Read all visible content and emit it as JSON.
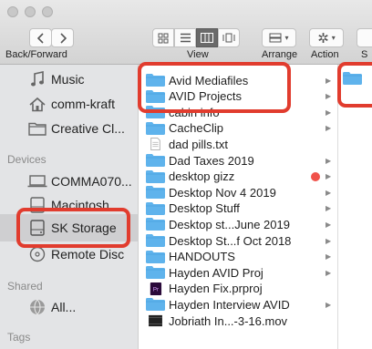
{
  "toolbar": {
    "nav_label": "Back/Forward",
    "view_label": "View",
    "arrange_label": "Arrange",
    "action_label": "Action",
    "clipped_label": "S"
  },
  "sidebar": {
    "favorites": [
      {
        "label": "Music",
        "icon": "music-note-icon"
      },
      {
        "label": "comm-kraft",
        "icon": "home-icon"
      },
      {
        "label": "Creative Cl...",
        "icon": "folder-icon"
      }
    ],
    "devices_header": "Devices",
    "devices": [
      {
        "label": "COMMA070...",
        "icon": "laptop-icon"
      },
      {
        "label": "Macintosh...",
        "icon": "disk-icon"
      },
      {
        "label": "SK Storage",
        "icon": "disk-icon"
      },
      {
        "label": "Remote Disc",
        "icon": "disc-icon"
      }
    ],
    "shared_header": "Shared",
    "shared": [
      {
        "label": "All...",
        "icon": "network-icon"
      }
    ],
    "tags_header": "Tags"
  },
  "files": [
    {
      "name": "Avid Mediafiles",
      "type": "folder",
      "chevron": true
    },
    {
      "name": "AVID Projects",
      "type": "folder",
      "chevron": true
    },
    {
      "name": "cabin info",
      "type": "folder",
      "chevron": true
    },
    {
      "name": "CacheClip",
      "type": "folder",
      "chevron": true
    },
    {
      "name": "dad pills.txt",
      "type": "text",
      "chevron": false
    },
    {
      "name": "Dad Taxes 2019",
      "type": "folder",
      "chevron": true
    },
    {
      "name": "desktop gizz",
      "type": "folder",
      "chevron": true,
      "tag_color": "#f0524a"
    },
    {
      "name": "Desktop Nov 4 2019",
      "type": "folder",
      "chevron": true
    },
    {
      "name": "Desktop Stuff",
      "type": "folder",
      "chevron": true
    },
    {
      "name": "Desktop st...June 2019",
      "type": "folder",
      "chevron": true
    },
    {
      "name": "Desktop St...f Oct 2018",
      "type": "folder",
      "chevron": true
    },
    {
      "name": "HANDOUTS",
      "type": "folder",
      "chevron": true
    },
    {
      "name": "Hayden AVID Proj",
      "type": "folder",
      "chevron": true
    },
    {
      "name": "Hayden Fix.prproj",
      "type": "premiere",
      "chevron": false
    },
    {
      "name": "Hayden Interview AVID",
      "type": "folder",
      "chevron": true
    },
    {
      "name": "Jobriath In...-3-16.mov",
      "type": "movie",
      "chevron": false
    }
  ],
  "colors": {
    "folder": "#5fb3ec",
    "folder_tab": "#4ea6e2",
    "annotation": "#e13c2e",
    "selection": "#cfcfd1"
  }
}
